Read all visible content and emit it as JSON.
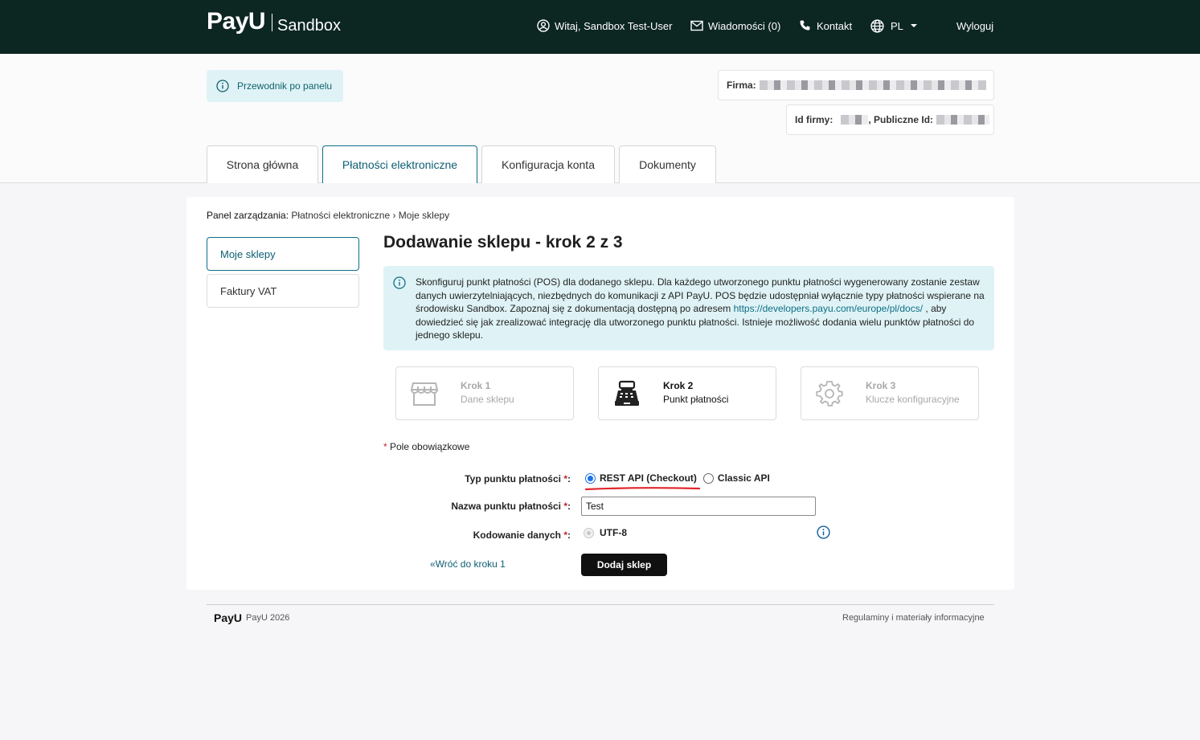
{
  "header": {
    "logo_text": "PayU",
    "logo_sub": "Sandbox",
    "welcome": "Witaj, Sandbox Test-User",
    "messages": "Wiadomości (0)",
    "contact": "Kontakt",
    "language": "PL",
    "logout": "Wyloguj",
    "bg_color": "#0c2622"
  },
  "guide": {
    "label": "Przewodnik po panelu"
  },
  "company": {
    "firma_label": "Firma:",
    "id_label": "Id firmy:",
    "public_id_label": ", Publiczne Id:"
  },
  "tabs": [
    {
      "label": "Strona główna"
    },
    {
      "label": "Płatności elektroniczne"
    },
    {
      "label": "Konfiguracja konta"
    },
    {
      "label": "Dokumenty"
    }
  ],
  "breadcrumb": {
    "lead": "Panel zarządzania:",
    "path": " Płatności elektroniczne › Moje sklepy"
  },
  "sidebar": {
    "items": [
      {
        "label": "Moje sklepy"
      },
      {
        "label": "Faktury VAT"
      }
    ]
  },
  "page": {
    "title": "Dodawanie sklepu - krok 2 z 3",
    "notice_part1": "Skonfiguruj punkt płatności (POS) dla dodanego sklepu. Dla każdego utworzonego punktu płatności wygenerowany zostanie zestaw danych uwierzytelniających, niezbędnych do komunikacji z API PayU. POS będzie udostępniał wyłącznie typy płatności wspierane na środowisku Sandbox. Zapoznaj się z dokumentacją dostępną po adresem ",
    "notice_link": "https://developers.payu.com/europe/pl/docs/",
    "notice_part2": " , aby dowiedzieć się jak zrealizować integrację dla utworzonego punktu płatności. Istnieje możliwość dodania wielu punktów płatności do jednego sklepu."
  },
  "steps": [
    {
      "title": "Krok 1",
      "subtitle": "Dane sklepu",
      "icon": "store-icon"
    },
    {
      "title": "Krok 2",
      "subtitle": "Punkt płatności",
      "icon": "cash-register-icon"
    },
    {
      "title": "Krok 3",
      "subtitle": "Klucze konfiguracyjne",
      "icon": "gear-icon"
    }
  ],
  "form": {
    "required_note": " Pole obowiązkowe",
    "star": "*",
    "type_label": "Typ punktu płatności ",
    "type_options": [
      "REST API (Checkout)",
      "Classic API"
    ],
    "type_selected": "REST API (Checkout)",
    "name_label": "Nazwa punktu płatności ",
    "name_value": "Test",
    "encoding_label": "Kodowanie danych ",
    "encoding_value": "UTF-8",
    "colon": ":",
    "back_link": "«Wróć do kroku 1",
    "submit": "Dodaj sklep"
  },
  "footer": {
    "logo": "PayU",
    "copyright": "PayU 2026",
    "links": "Regulaminy i materiały informacyjne"
  }
}
